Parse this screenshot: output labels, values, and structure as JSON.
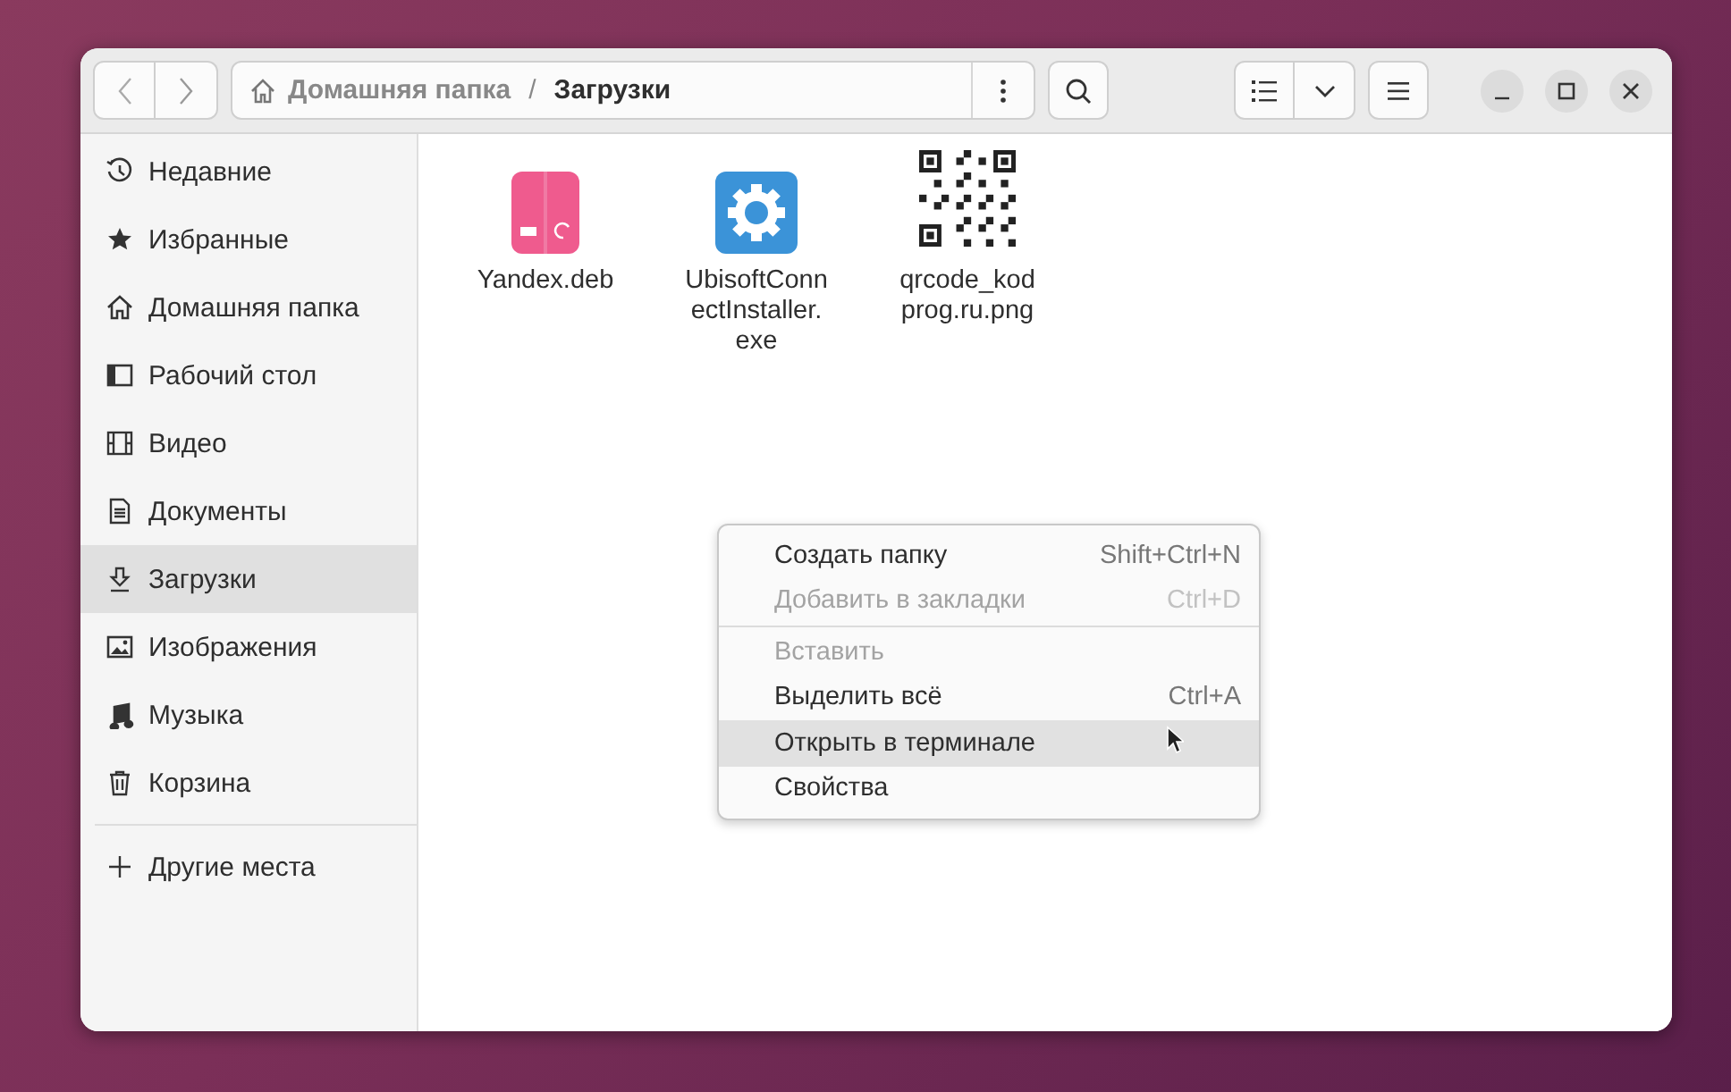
{
  "path_bar": {
    "crumbs": [
      {
        "label": "Домашняя папка",
        "selected": false
      },
      {
        "label": "Загрузки",
        "selected": true
      }
    ],
    "separator": "/"
  },
  "sidebar": {
    "items": [
      {
        "label": "Недавние",
        "selected": false
      },
      {
        "label": "Избранные",
        "selected": false
      },
      {
        "label": "Домашняя папка",
        "selected": false
      },
      {
        "label": "Рабочий стол",
        "selected": false
      },
      {
        "label": "Видео",
        "selected": false
      },
      {
        "label": "Документы",
        "selected": false
      },
      {
        "label": "Загрузки",
        "selected": true
      },
      {
        "label": "Изображения",
        "selected": false
      },
      {
        "label": "Музыка",
        "selected": false
      },
      {
        "label": "Корзина",
        "selected": false
      }
    ],
    "other": {
      "label": "Другие места"
    }
  },
  "files": [
    {
      "name": "Yandex.deb",
      "kind": "package"
    },
    {
      "name": "UbisoftConnectInstaller.exe",
      "kind": "executable"
    },
    {
      "name": "qrcode_kodprog.ru.png",
      "kind": "image"
    }
  ],
  "context_menu": {
    "sections": [
      [
        {
          "label": "Создать папку",
          "shortcut": "Shift+Ctrl+N",
          "disabled": false,
          "selected": false
        },
        {
          "label": "Добавить в закладки",
          "shortcut": "Ctrl+D",
          "disabled": true,
          "selected": false
        }
      ],
      [
        {
          "label": "Вставить",
          "disabled": true,
          "selected": false
        },
        {
          "label": "Выделить всё",
          "shortcut": "Ctrl+A",
          "disabled": false,
          "selected": false
        },
        {
          "label": "Открыть в терминале",
          "disabled": false,
          "selected": true
        },
        {
          "label": "Свойства",
          "disabled": false,
          "selected": false
        }
      ]
    ]
  }
}
